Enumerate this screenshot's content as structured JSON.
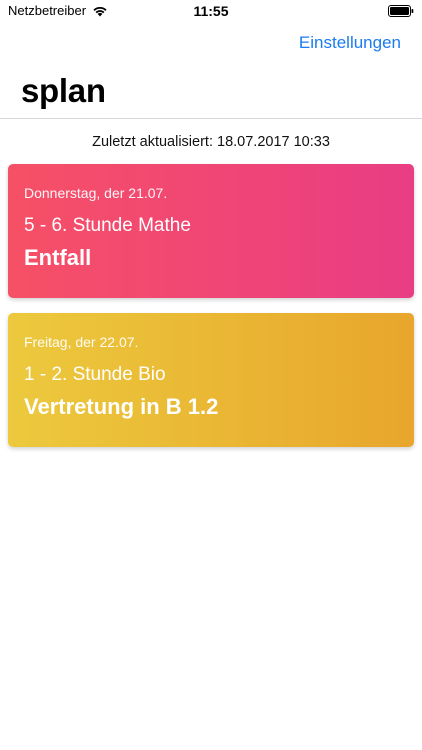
{
  "status_bar": {
    "carrier": "Netzbetreiber",
    "time": "11:55",
    "wifi_icon": "wifi-icon",
    "battery_icon": "battery-icon"
  },
  "nav": {
    "settings_label": "Einstellungen",
    "title": "splan"
  },
  "last_updated": "Zuletzt aktualisiert: 18.07.2017 10:33",
  "cards": [
    {
      "date": "Donnerstag, der 21.07.",
      "lesson": "5 - 6. Stunde Mathe",
      "status": "Entfall",
      "gradient_start": "#f65066",
      "gradient_end": "#e93d84"
    },
    {
      "date": "Freitag, der 22.07.",
      "lesson": "1 - 2. Stunde Bio",
      "status": "Vertretung in B 1.2",
      "gradient_start": "#ecc93d",
      "gradient_end": "#e8a62c"
    }
  ],
  "colors": {
    "accent": "#1a7cf0",
    "background": "#ffffff"
  }
}
